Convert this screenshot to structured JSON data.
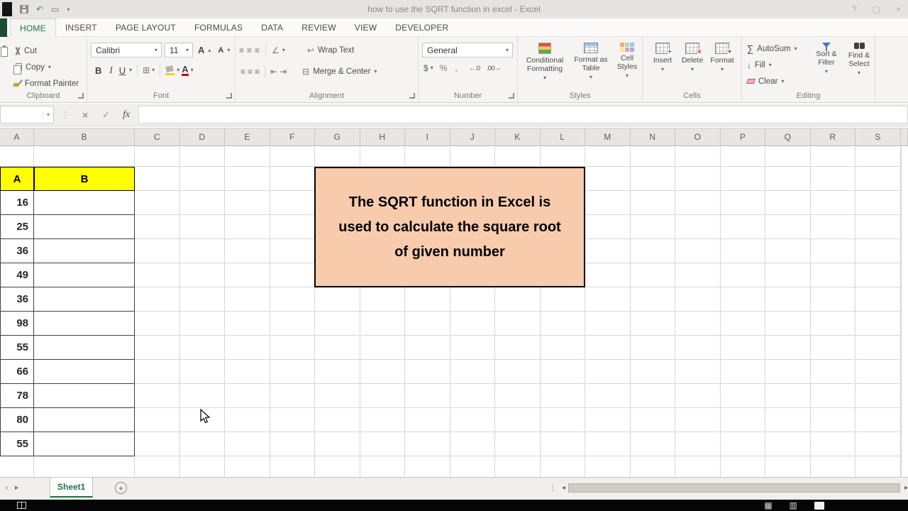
{
  "title_bar": {
    "title": "how to use the SQRT function in excel - Excel"
  },
  "window_controls": {
    "help": "?",
    "restore": "▢",
    "close": "×"
  },
  "ribbon_tabs": [
    {
      "label": "HOME",
      "active": true
    },
    {
      "label": "INSERT"
    },
    {
      "label": "PAGE LAYOUT"
    },
    {
      "label": "FORMULAS"
    },
    {
      "label": "DATA"
    },
    {
      "label": "REVIEW"
    },
    {
      "label": "VIEW"
    },
    {
      "label": "DEVELOPER"
    }
  ],
  "ribbon": {
    "clipboard": {
      "label": "Clipboard",
      "cut": "Cut",
      "copy": "Copy",
      "format_painter": "Format Painter"
    },
    "font": {
      "label": "Font",
      "family": "Calibri",
      "size": "11",
      "bold": "B",
      "italic": "I",
      "underline": "U",
      "grow": "A",
      "shrink": "A",
      "font_color": "A"
    },
    "alignment": {
      "label": "Alignment",
      "wrap_text": "Wrap Text",
      "merge_center": "Merge & Center"
    },
    "number": {
      "label": "Number",
      "format": "General",
      "currency": "$",
      "percent": "%",
      "comma": ",",
      "increase_decimal": "←.0",
      "decrease_decimal": ".00→"
    },
    "styles": {
      "label": "Styles",
      "conditional": "Conditional Formatting",
      "format_table": "Format as Table",
      "cell_styles": "Cell Styles"
    },
    "cells": {
      "label": "Cells",
      "insert": "Insert",
      "delete": "Delete",
      "format": "Format"
    },
    "editing": {
      "label": "Editing",
      "autosum": "AutoSum",
      "fill": "Fill",
      "clear": "Clear",
      "sort_filter": "Sort & Filter",
      "find_select": "Find & Select"
    }
  },
  "formula_bar": {
    "name_box": "",
    "formula": "",
    "fx": "fx",
    "cancel": "×",
    "enter": "✓"
  },
  "sheet": {
    "columns": [
      "A",
      "B",
      "C",
      "D",
      "E",
      "F",
      "G",
      "H",
      "I",
      "J",
      "K",
      "L",
      "M",
      "N",
      "O",
      "P",
      "Q",
      "R",
      "S"
    ],
    "table_header": [
      "A",
      "B"
    ],
    "column_a_values": [
      "16",
      "25",
      "36",
      "49",
      "36",
      "98",
      "55",
      "66",
      "78",
      "80",
      "55"
    ],
    "colors": {
      "header_fill": "#ffff00",
      "callout_fill": "#f8cbad",
      "accent_green": "#217346"
    }
  },
  "callout": {
    "lines": [
      "The SQRT function in Excel is",
      "used to calculate the square root",
      "of given number"
    ]
  },
  "sheet_bar": {
    "tab": "Sheet1"
  },
  "icons": {
    "caret": "▾",
    "up_caret": "▴",
    "sigma": "∑",
    "borders": "⊞",
    "merge": "⊟",
    "align": "≡",
    "wrap": "↩",
    "orientation": "∠",
    "fill_down": "↓",
    "nav_left": "◂",
    "nav_right": "▸",
    "dots": "⋮",
    "plus": "+",
    "undo": "↶",
    "window": "▭",
    "grid": "▦",
    "rows": "▥",
    "indent_left": "⇤",
    "indent_right": "⇥"
  }
}
